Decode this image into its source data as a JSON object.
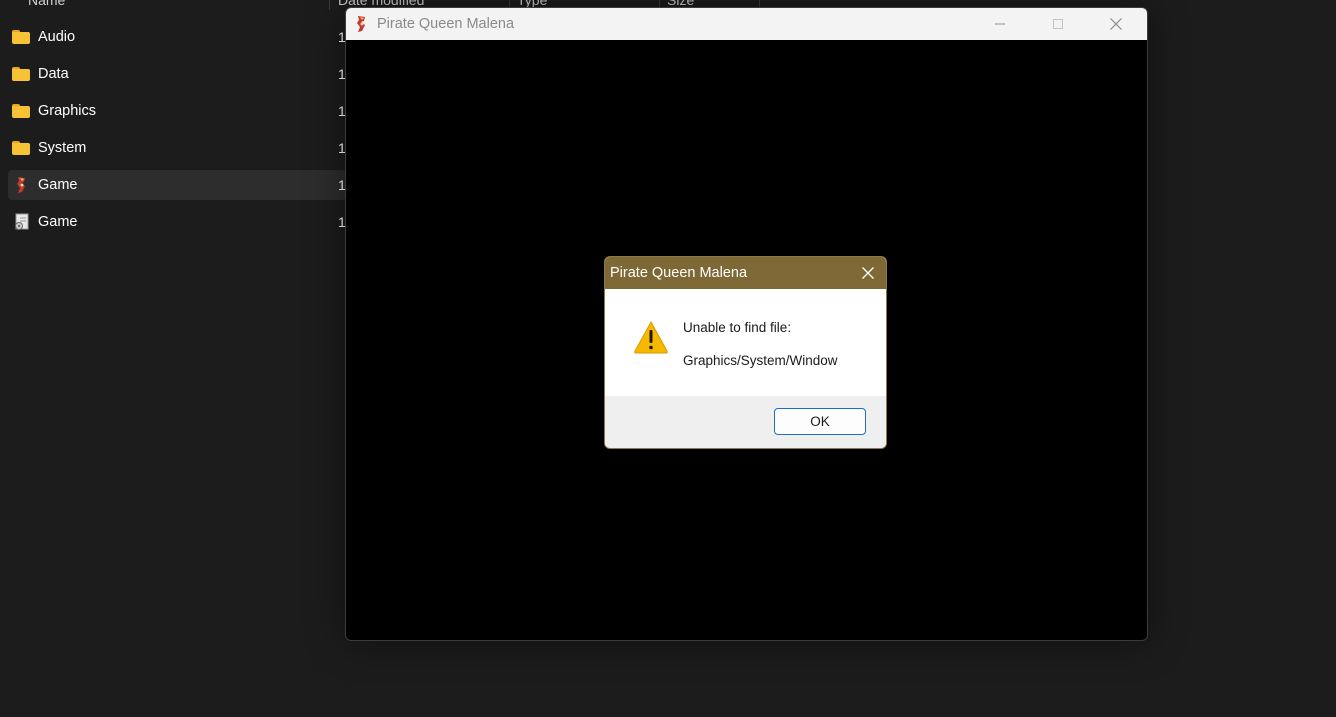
{
  "explorer": {
    "columns": [
      "Name",
      "Date modified",
      "Type",
      "Size"
    ],
    "files": [
      {
        "name": "Audio",
        "date": "1",
        "kind": "folder"
      },
      {
        "name": "Data",
        "date": "1",
        "kind": "folder"
      },
      {
        "name": "Graphics",
        "date": "1",
        "kind": "folder"
      },
      {
        "name": "System",
        "date": "1",
        "kind": "folder"
      },
      {
        "name": "Game",
        "date": "1",
        "kind": "app",
        "selected": true
      },
      {
        "name": "Game",
        "date": "1",
        "kind": "config"
      }
    ]
  },
  "game_window": {
    "title": "Pirate Queen Malena",
    "buttons": [
      "minimize-icon",
      "maximize-icon",
      "close-icon"
    ]
  },
  "dialog": {
    "title": "Pirate Queen Malena",
    "message_line1": "Unable to find file:",
    "message_line2": "Graphics/System/Window",
    "ok_label": "OK",
    "icon": "warning-icon"
  },
  "colors": {
    "explorer_bg": "#1c1c1c",
    "folder": "#f7c235",
    "dialog_title_bg": "#7e6936",
    "accent": "#1a6fce"
  }
}
